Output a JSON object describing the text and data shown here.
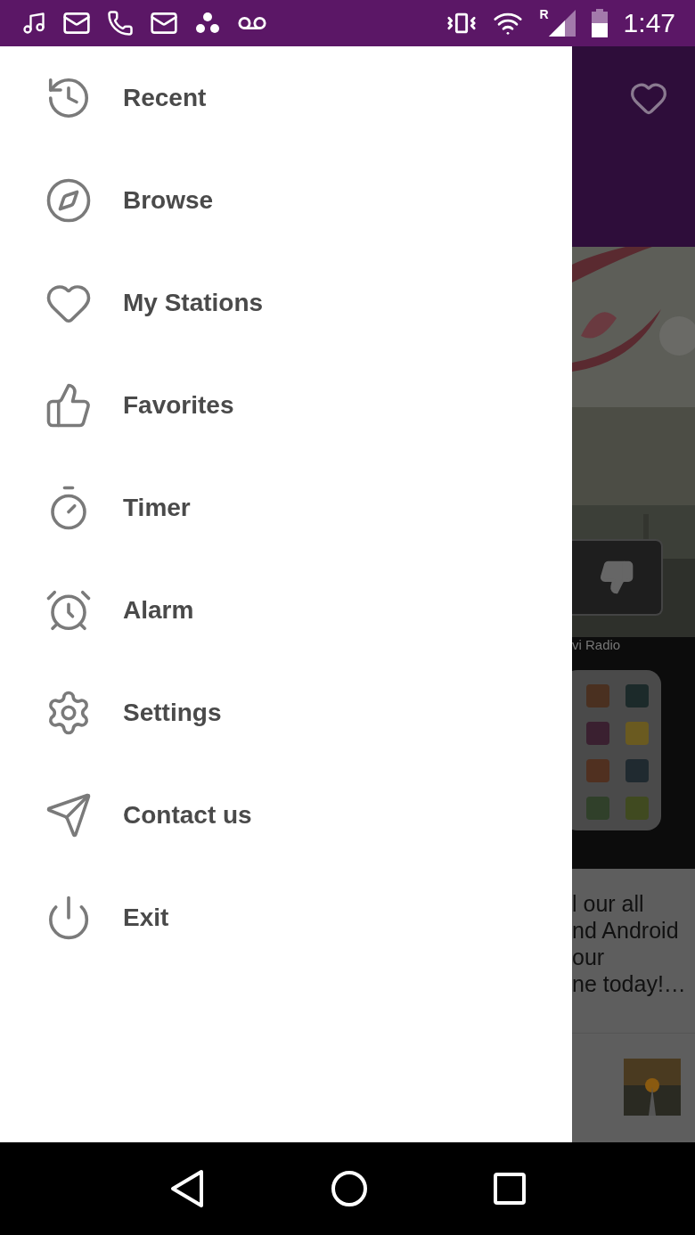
{
  "status_bar": {
    "roaming": "R",
    "time": "1:47"
  },
  "drawer": {
    "items": [
      {
        "kind": "recent",
        "label": "Recent"
      },
      {
        "kind": "browse",
        "label": "Browse"
      },
      {
        "kind": "stations",
        "label": "My Stations"
      },
      {
        "kind": "favorites",
        "label": "Favorites"
      },
      {
        "kind": "timer",
        "label": "Timer"
      },
      {
        "kind": "alarm",
        "label": "Alarm"
      },
      {
        "kind": "settings",
        "label": "Settings"
      },
      {
        "kind": "contact",
        "label": "Contact us"
      },
      {
        "kind": "exit",
        "label": "Exit"
      }
    ]
  },
  "background": {
    "station_caption": "vi Radio",
    "description_lines": [
      "l our all",
      "nd Android",
      "our",
      "ne today!…"
    ]
  }
}
